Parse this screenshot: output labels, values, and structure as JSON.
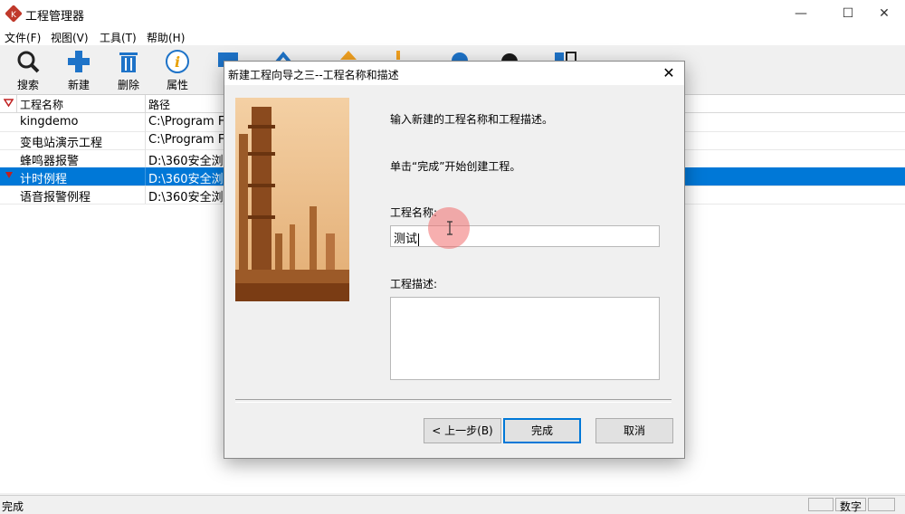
{
  "window": {
    "title": "工程管理器"
  },
  "menu": [
    "文件(F)",
    "视图(V)",
    "工具(T)",
    "帮助(H)"
  ],
  "toolbar": {
    "search": "搜索",
    "new": "新建",
    "delete": "删除",
    "properties": "属性"
  },
  "list": {
    "headers": {
      "name": "工程名称",
      "path": "路径"
    },
    "rows": [
      {
        "name": "kingdemo",
        "path": "C:\\Program Fi"
      },
      {
        "name": "变电站演示工程",
        "path": "C:\\Program Fi"
      },
      {
        "name": "蜂鸣器报警",
        "path": "D:\\360安全浏览"
      },
      {
        "name": "计时例程",
        "path": "D:\\360安全浏览"
      },
      {
        "name": "语音报警例程",
        "path": "D:\\360安全浏览"
      }
    ]
  },
  "status": {
    "text": "完成",
    "numlock": "数字"
  },
  "dialog": {
    "title": "新建工程向导之三--工程名称和描述",
    "intro": "输入新建的工程名称和工程描述。",
    "hint": "单击“完成”开始创建工程。",
    "name_label": "工程名称:",
    "name_value": "测试",
    "desc_label": "工程描述:",
    "desc_value": "",
    "back_button": "< 上一步(B)",
    "finish_button": "完成",
    "cancel_button": "取消"
  },
  "colors": {
    "selection": "#0078d7",
    "accent_icon": "#1e73c8",
    "click_indicator": "#f06e6e"
  }
}
